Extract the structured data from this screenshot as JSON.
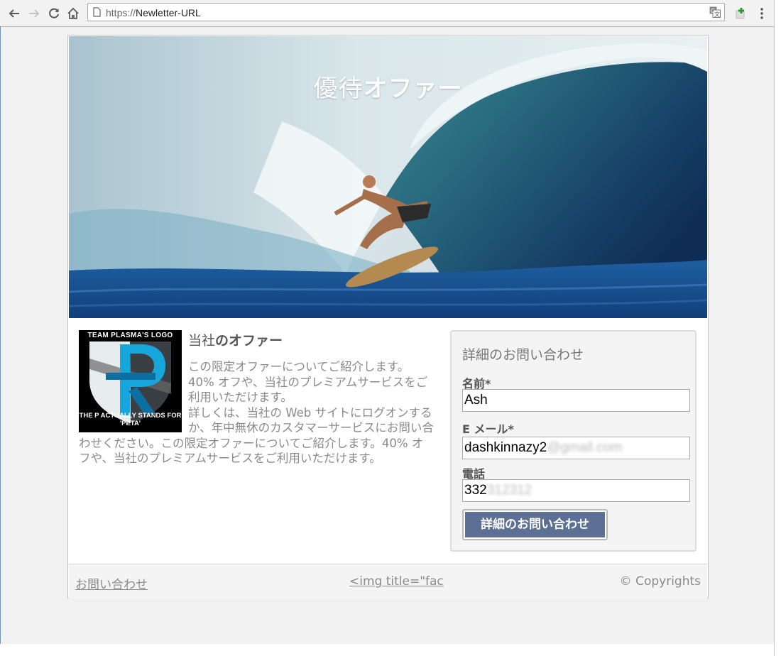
{
  "browser": {
    "url_protocol": "https://",
    "url_path": "Newletter-URL",
    "icons": [
      "back-arrow-icon",
      "forward-arrow-icon",
      "reload-icon",
      "home-icon",
      "page-icon",
      "translate-icon",
      "extension-icon",
      "menu-dots-icon"
    ]
  },
  "hero": {
    "title_part1": "優待",
    "title_part2": "オファー"
  },
  "logo": {
    "top_text": "TEAM PLASMA'S LOGO",
    "bottom_text": "THE P ACTUALLY STANDS FOR 'PETA'"
  },
  "offer": {
    "title_part1": "当社",
    "title_part2": "のオファー",
    "paragraph1": "この限定オファーについてご紹介します。40% オフや、当社のプレミアムサービスをご利用いただけます。",
    "paragraph2": "詳しくは、当社の Web サイトにログオンするか、年中無休のカスタマーサービスにお問い合わせください。この限定オファーについてご紹介します。40% オフや、当社のプレミアムサービスをご利用いただけます。"
  },
  "form": {
    "title": "詳細のお問い合わせ",
    "name_label": "名前*",
    "name_value": "Ash",
    "email_label": "E メール*",
    "email_value": "dashkinnazy2",
    "email_value_blurred": "@gmail.com",
    "phone_label": "電話",
    "phone_value": "332",
    "phone_value_blurred": "312312",
    "submit_label": "詳細のお問い合わせ"
  },
  "footer": {
    "contact_link": "お問い合わせ",
    "img_link": "<img title=\"fac",
    "copyright": "© Copyrights"
  },
  "colors": {
    "button": "#5c6f94",
    "text_gray": "#8a8a8a",
    "form_bg": "#f4f4f4"
  }
}
